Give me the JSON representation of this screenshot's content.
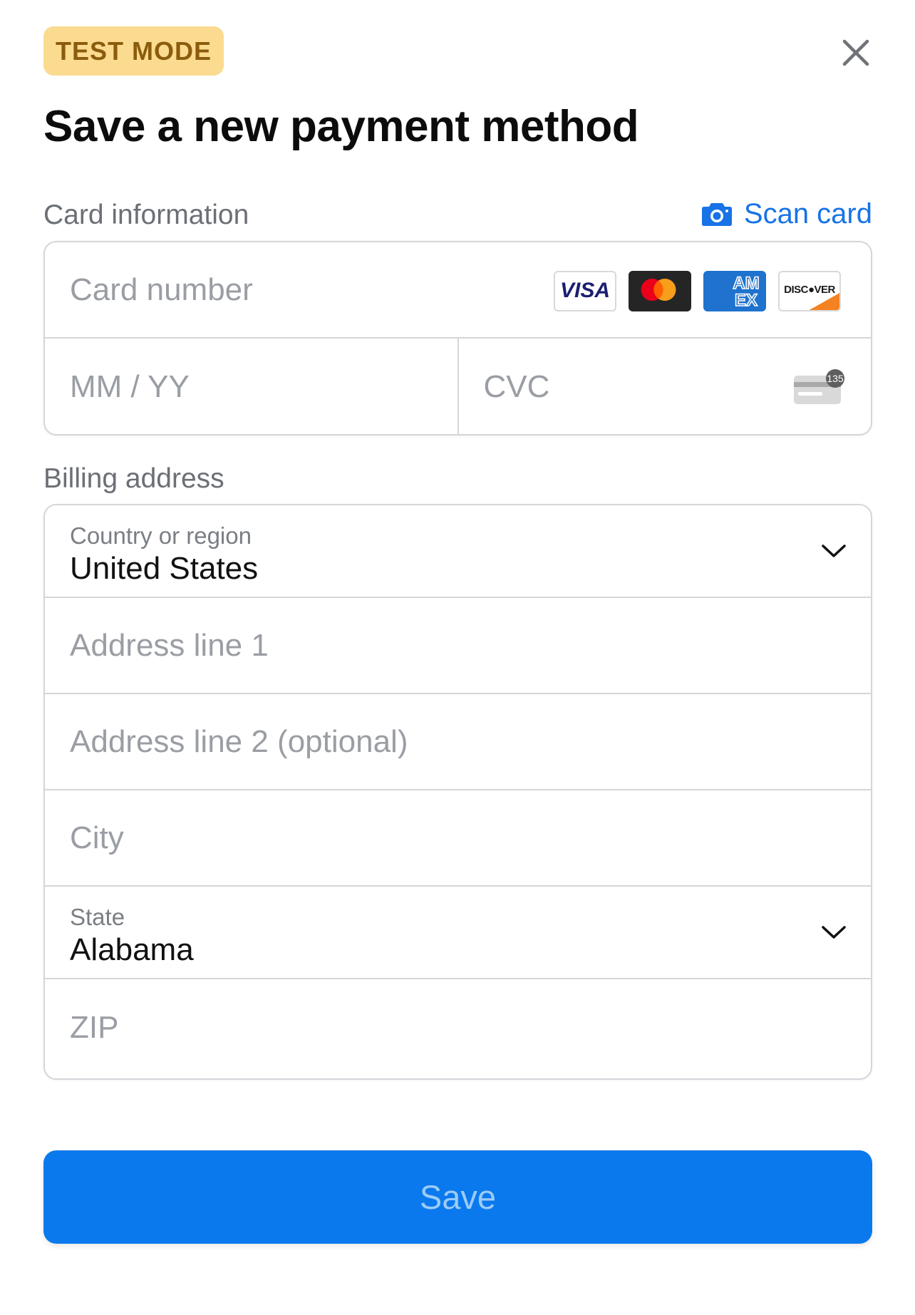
{
  "badge": {
    "label": "TEST MODE"
  },
  "title": "Save a new payment method",
  "card_section": {
    "label": "Card information",
    "scan_label": "Scan card",
    "card_number_placeholder": "Card number",
    "expiry_placeholder": "MM / YY",
    "cvc_placeholder": "CVC",
    "cvc_hint": "135",
    "brands": {
      "visa": "VISA",
      "amex_top": "AM",
      "amex_bottom": "EX",
      "discover": "DISC●VER"
    }
  },
  "billing_section": {
    "label": "Billing address",
    "country": {
      "label": "Country or region",
      "value": "United States"
    },
    "address1_placeholder": "Address line 1",
    "address2_placeholder": "Address line 2 (optional)",
    "city_placeholder": "City",
    "state": {
      "label": "State",
      "value": "Alabama"
    },
    "zip_placeholder": "ZIP"
  },
  "save_label": "Save",
  "colors": {
    "accent": "#0a79ed",
    "link": "#1773e6",
    "badge_bg": "#fbdb90",
    "badge_text": "#8b5c0d",
    "border": "#d4d6da"
  },
  "icons": {
    "close": "close-icon",
    "camera": "camera-icon",
    "cvc": "cvc-card-icon",
    "chevron": "chevron-down-icon"
  }
}
